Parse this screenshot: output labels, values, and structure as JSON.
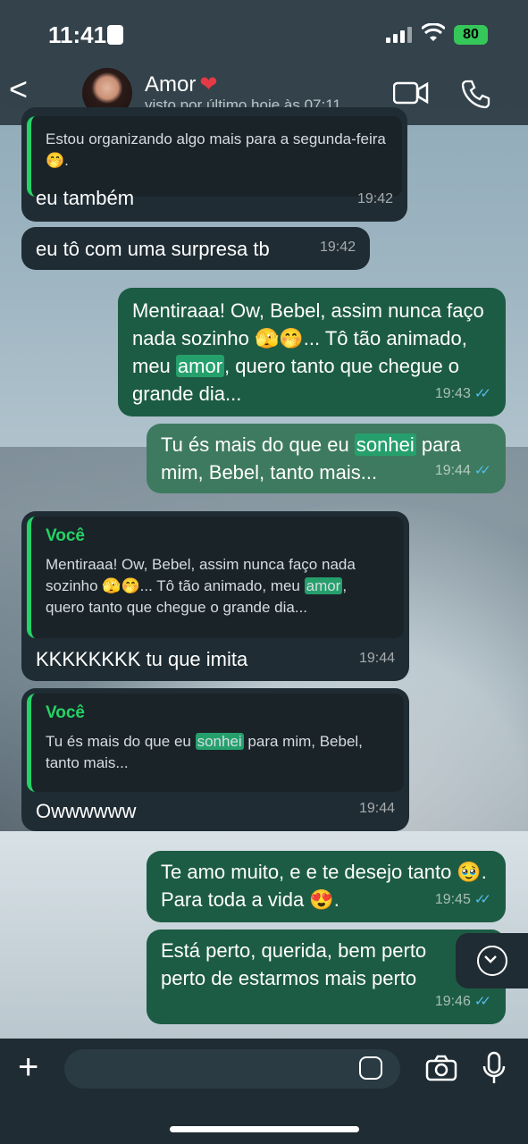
{
  "status_bar": {
    "time": "11:41",
    "battery": "80"
  },
  "header": {
    "back_label": "<",
    "contact_name": "Amor",
    "heart": "❤",
    "last_seen": "visto por último hoje às 07:11"
  },
  "messages": [
    {
      "type": "in",
      "quoted_text": "Estou organizando algo mais para a segunda-feira 🤭.",
      "text": "eu também",
      "time": "19:42"
    },
    {
      "type": "in",
      "text": "eu tô com uma surpresa tb",
      "time": "19:42"
    },
    {
      "type": "out",
      "text_before": "Mentiraaa! Ow, Bebel, assim nunca faço nada sozinho 🫣🤭... Tô tão animado, meu ",
      "highlight": "amor",
      "text_after": ", quero tanto que chegue o grande dia...",
      "time": "19:43"
    },
    {
      "type": "out",
      "text_before": "Tu és mais do que eu ",
      "highlight": "sonhei",
      "text_after": " para mim, Bebel, tanto mais...",
      "time": "19:44"
    },
    {
      "type": "in",
      "quote_author": "Você",
      "quote_before": "Mentiraaa! Ow, Bebel, assim nunca faço nada sozinho 🫣🤭... Tô tão animado, meu ",
      "quote_highlight": "amor",
      "quote_after": ", quero tanto que chegue o grande dia...",
      "text": "KKKKKKKK tu que imita",
      "time": "19:44"
    },
    {
      "type": "in",
      "quote_author": "Você",
      "quote_before": "Tu és mais do que eu ",
      "quote_highlight": "sonhei",
      "quote_after": " para mim, Bebel, tanto mais...",
      "text": "Owwwwww",
      "time": "19:44"
    },
    {
      "type": "out",
      "text": "Te amo muito, e e te desejo tanto 🥹. Para toda a vida 😍.",
      "time": "19:45"
    },
    {
      "type": "out",
      "text": "Está perto, querida, bem perto perto de estarmos mais perto",
      "time": "19:46"
    }
  ],
  "ticks": "✓✓",
  "composer": {
    "placeholder": ""
  }
}
